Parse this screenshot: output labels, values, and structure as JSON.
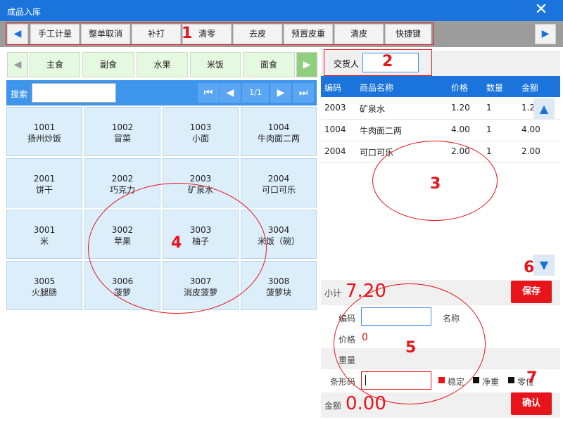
{
  "window": {
    "title": "成品入库",
    "close_glyph": "✕"
  },
  "toolbar": {
    "left_arrow": "◀",
    "right_arrow": "▶",
    "buttons": [
      "手工计量",
      "整单取消",
      "补打",
      "清零",
      "去皮",
      "预置皮重",
      "清皮",
      "快捷键"
    ]
  },
  "categories": {
    "left_arrow": "◀",
    "right_arrow": "▶",
    "items": [
      "主食",
      "副食",
      "水果",
      "米饭",
      "面食"
    ]
  },
  "search": {
    "label": "搜索",
    "value": "",
    "page": "1/1",
    "first": "⏮",
    "prev": "◀",
    "next": "▶",
    "last": "⏭"
  },
  "products": [
    {
      "code": "1001",
      "name": "扬州炒饭"
    },
    {
      "code": "1002",
      "name": "冒菜"
    },
    {
      "code": "1003",
      "name": "小面"
    },
    {
      "code": "1004",
      "name": "牛肉面二两"
    },
    {
      "code": "2001",
      "name": "饼干"
    },
    {
      "code": "2002",
      "name": "巧克力"
    },
    {
      "code": "2003",
      "name": "矿泉水"
    },
    {
      "code": "2004",
      "name": "可口可乐"
    },
    {
      "code": "3001",
      "name": "米"
    },
    {
      "code": "3002",
      "name": "苹果"
    },
    {
      "code": "3003",
      "name": "柚子"
    },
    {
      "code": "3004",
      "name": "米饭（碗）"
    },
    {
      "code": "3005",
      "name": "火腿肠"
    },
    {
      "code": "3006",
      "name": "菠萝"
    },
    {
      "code": "3007",
      "name": "消皮菠萝"
    },
    {
      "code": "3008",
      "name": "菠萝块"
    }
  ],
  "delivery": {
    "label": "交货人",
    "value": ""
  },
  "table": {
    "headers": [
      "编码",
      "商品名称",
      "价格",
      "数量",
      "金额"
    ],
    "rows": [
      [
        "2003",
        "矿泉水",
        "1.20",
        "1",
        "1.20"
      ],
      [
        "1004",
        "牛肉面二两",
        "4.00",
        "1",
        "4.00"
      ],
      [
        "2004",
        "可口可乐",
        "2.00",
        "1",
        "2.00"
      ]
    ],
    "scroll_up": "▲",
    "scroll_down": "▼"
  },
  "summary": {
    "subtotal_label": "小计",
    "subtotal_value": "7.20",
    "save_label": "保存"
  },
  "form": {
    "code_label": "编码",
    "code_value": "",
    "name_label": "名称",
    "price_label": "价格",
    "price_value": "0",
    "weight_label": "重量",
    "barcode_label": "条形码",
    "barcode_value": "",
    "indicators": [
      "稳定",
      "净重",
      "零位"
    ],
    "indicator_colors": [
      "#e8141b",
      "#111111",
      "#111111"
    ]
  },
  "total": {
    "label": "金额",
    "value": "0.00",
    "confirm_label": "确认"
  },
  "annotations": [
    "1",
    "2",
    "3",
    "4",
    "5",
    "6",
    "7"
  ]
}
